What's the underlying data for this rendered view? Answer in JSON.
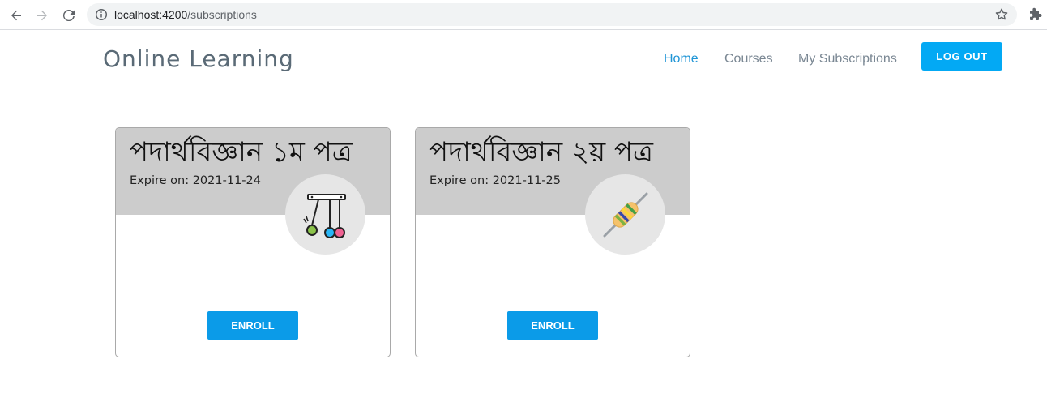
{
  "browser": {
    "url_host": "localhost:4200",
    "url_path": "/subscriptions"
  },
  "header": {
    "brand": "Online Learning",
    "nav": {
      "home": "Home",
      "courses": "Courses",
      "my_subscriptions": "My Subscriptions"
    },
    "logout_label": "LOG OUT",
    "active_color": "#1f95d6",
    "button_color": "#03a9f4"
  },
  "subscriptions": [
    {
      "title": "পদার্থবিজ্ঞান ১ম পত্র",
      "expire": "Expire on: 2021-11-24",
      "icon": "newtons-cradle-icon",
      "button": "ENROLL"
    },
    {
      "title": "পদার্থবিজ্ঞান ২য় পত্র",
      "expire": "Expire on: 2021-11-25",
      "icon": "resistor-icon",
      "button": "ENROLL"
    }
  ]
}
